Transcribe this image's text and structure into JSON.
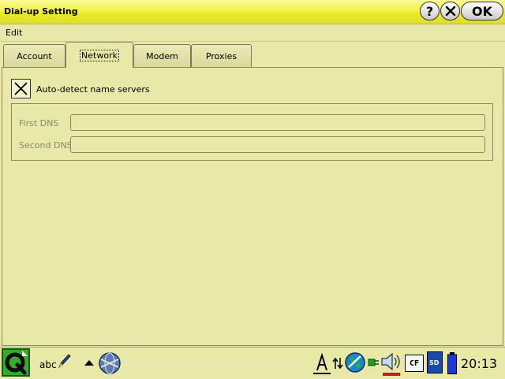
{
  "window": {
    "title": "Dial-up Setting"
  },
  "titlebar": {
    "ok_label": "OK",
    "help_glyph": "?"
  },
  "menu": {
    "edit": "Edit"
  },
  "tabs": [
    {
      "label": "Account",
      "active": false
    },
    {
      "label": "Network",
      "active": true
    },
    {
      "label": "Modem",
      "active": false
    },
    {
      "label": "Proxies",
      "active": false
    }
  ],
  "network": {
    "auto_detect_label": "Auto-detect name servers",
    "auto_detect_checked": true,
    "first_dns_label": "First DNS",
    "first_dns_value": "",
    "second_dns_label": "Second DNS",
    "second_dns_value": ""
  },
  "taskbar": {
    "input_method_label": "abc",
    "cf_label": "CF",
    "sd_label": "SD",
    "clock": "20:13"
  },
  "colors": {
    "background": "#e8e8a8",
    "titlebar": "#f3f347",
    "battery": "#1a3ad8",
    "volume_bar": "#d01818"
  }
}
